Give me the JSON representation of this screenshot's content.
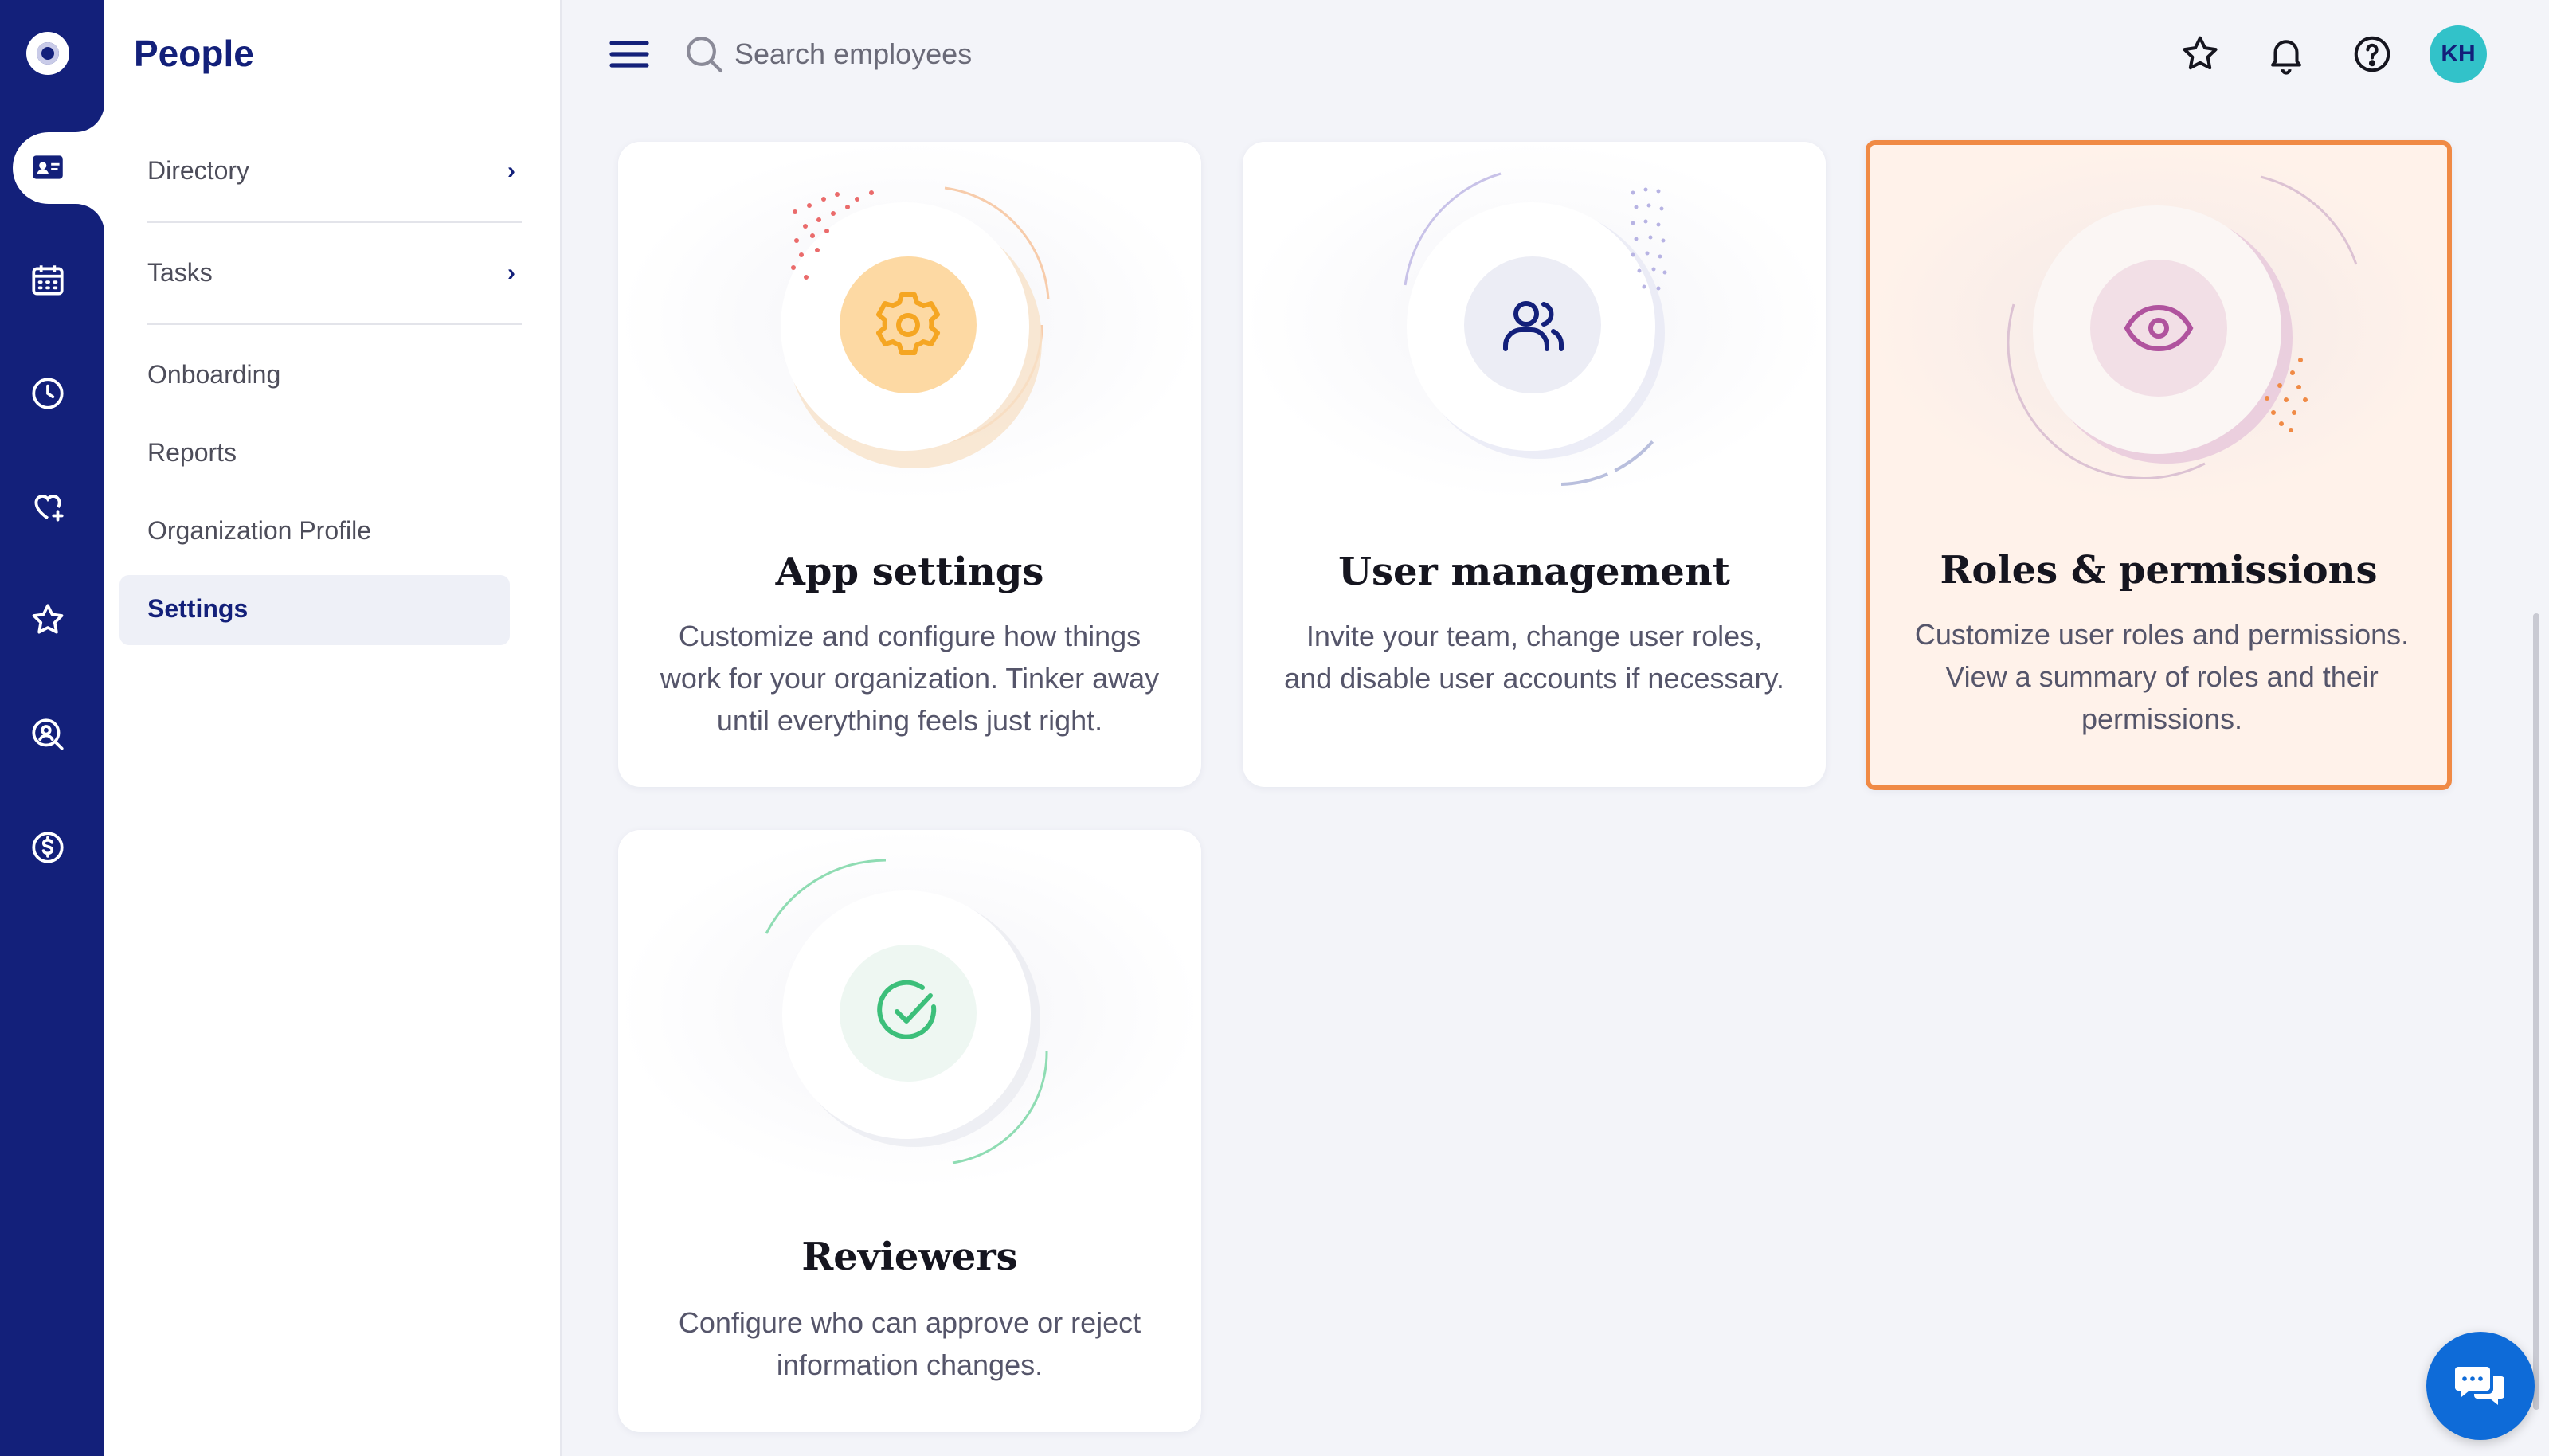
{
  "app": {
    "title": "People"
  },
  "rail": {
    "items": [
      {
        "name": "logo-icon"
      },
      {
        "name": "people-card-icon",
        "active": true
      },
      {
        "name": "calendar-icon"
      },
      {
        "name": "clock-icon"
      },
      {
        "name": "heart-plus-icon"
      },
      {
        "name": "star-icon"
      },
      {
        "name": "user-search-icon"
      },
      {
        "name": "dollar-icon"
      }
    ]
  },
  "sidebar": {
    "items": [
      {
        "label": "Directory",
        "has_children": true
      },
      {
        "label": "Tasks",
        "has_children": true
      },
      {
        "label": "Onboarding"
      },
      {
        "label": "Reports"
      },
      {
        "label": "Organization Profile"
      },
      {
        "label": "Settings",
        "active": true
      }
    ]
  },
  "topbar": {
    "search_placeholder": "Search employees",
    "avatar_initials": "KH"
  },
  "cards": [
    {
      "title": "App settings",
      "description": "Customize and configure how things work for your organization. Tinker away until everything feels just right.",
      "icon": "gear-icon",
      "accent": "#f5a623"
    },
    {
      "title": "User management",
      "description": "Invite your team, change user roles, and disable user accounts if necessary.",
      "icon": "users-icon",
      "accent": "#13207a"
    },
    {
      "title": "Roles & permissions",
      "description": "Customize user roles and permissions. View a summary of roles and their permissions.",
      "icon": "eye-icon",
      "accent": "#b0539e",
      "highlighted": true
    },
    {
      "title": "Reviewers",
      "description": "Configure who can approve or reject information changes.",
      "icon": "check-circle-icon",
      "accent": "#3cbf7a"
    }
  ],
  "colors": {
    "rail_bg": "#13207a",
    "highlight_border": "#f08a45",
    "chat_bg": "#0e6bd8"
  }
}
